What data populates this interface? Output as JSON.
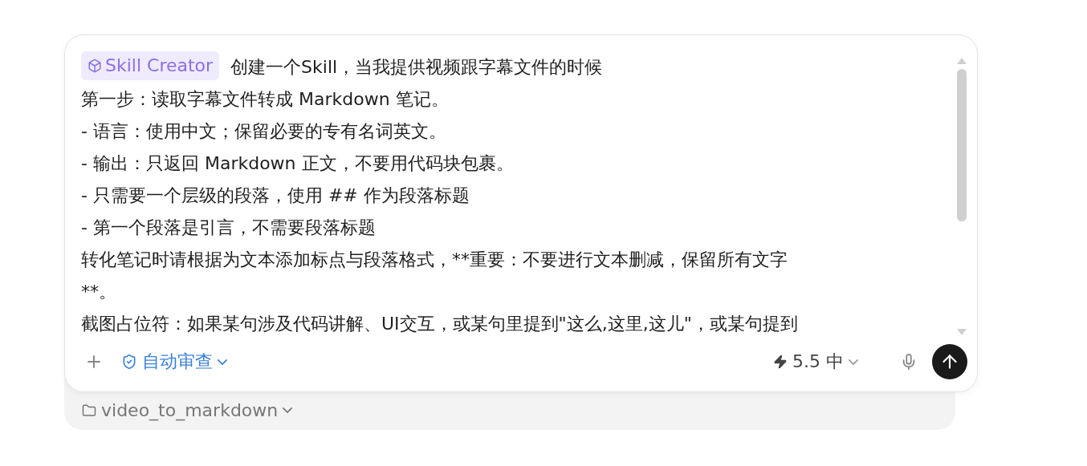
{
  "composer": {
    "skill_tag": "Skill Creator",
    "first_line": "创建一个Skill，当我提供视频跟字幕文件的时候",
    "lines": [
      "第一步：读取字幕文件转成 Markdown 笔记。",
      "- 语言：使用中文；保留必要的专有名词英文。",
      "- 输出：只返回 Markdown 正文，不要用代码块包裹。",
      "- 只需要一个层级的段落，使用 ## 作为段落标题",
      "- 第一个段落是引言，不需要段落标题",
      "转化笔记时请根据为文本添加标点与段落格式，**重要：不要进行文本删减，保留所有文字",
      "**。",
      "截图占位符：如果某句涉及代码讲解、UI交互，或某句里提到\"这么,这里,这儿\"，或某句提到"
    ],
    "toolbar": {
      "review_mode": "自动审查",
      "model": "5.5",
      "effort": "中"
    }
  },
  "project": {
    "name": "video_to_markdown"
  }
}
